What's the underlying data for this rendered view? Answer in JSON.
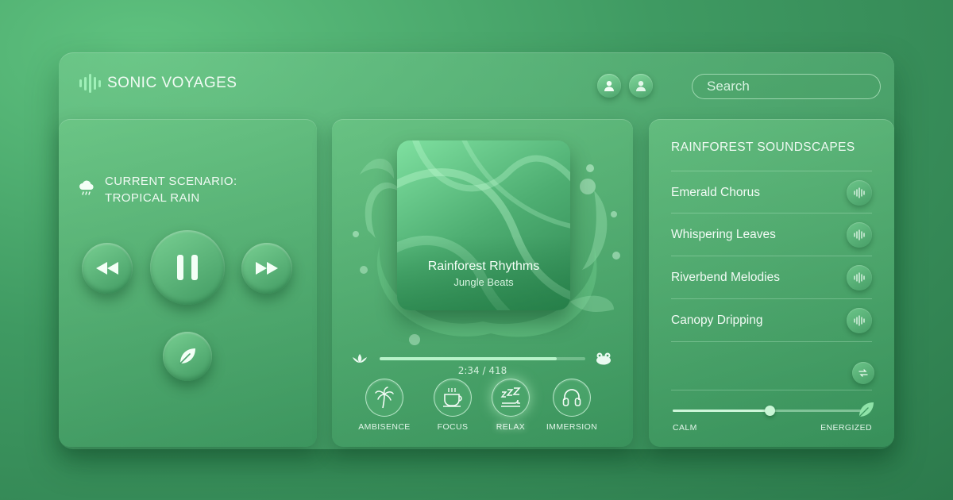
{
  "app": {
    "title": "SONIC VOYAGES"
  },
  "header": {
    "avatars": [
      "user-avatar-icon",
      "user-avatar-icon"
    ],
    "search_placeholder": "Search"
  },
  "scenario": {
    "icon": "rain-cloud-icon",
    "line1": "CURRENT SCENARIO:",
    "line2": "TROPICAL RAIN"
  },
  "controls": {
    "rewind": "rewind-icon",
    "play_pause": "pause-icon",
    "forward": "fast-forward-icon",
    "extra": "leaf-icon"
  },
  "now_playing": {
    "title": "Rainforest Rhythms",
    "subtitle": "Jungle Beats",
    "time": "2:34 / 418",
    "progress": 0.86,
    "left_icon": "lotus-icon",
    "right_icon": "frog-icon"
  },
  "modes": [
    {
      "label": "AMBISENCE",
      "icon": "palm-tree-icon",
      "active": false
    },
    {
      "label": "FOCUS",
      "icon": "coffee-cup-icon",
      "active": false
    },
    {
      "label": "RELAX",
      "icon": "sleep-icon",
      "active": true
    },
    {
      "label": "IMMERSION",
      "icon": "headphones-icon",
      "active": false
    }
  ],
  "playlist": {
    "title": "RAINFOREST SOUNDSCAPES",
    "items": [
      {
        "name": "Emerald Chorus"
      },
      {
        "name": "Whispering Leaves"
      },
      {
        "name": "Riverbend Melodies"
      },
      {
        "name": "Canopy Dripping"
      }
    ],
    "shuffle_icon": "repeat-icon"
  },
  "mood": {
    "left_label": "CALM",
    "right_label": "ENERGIZED",
    "value": 0.5,
    "end_icon": "leaf-icon"
  },
  "colors": {
    "accent": "#b7f3c9",
    "background": "#3f9a62"
  }
}
